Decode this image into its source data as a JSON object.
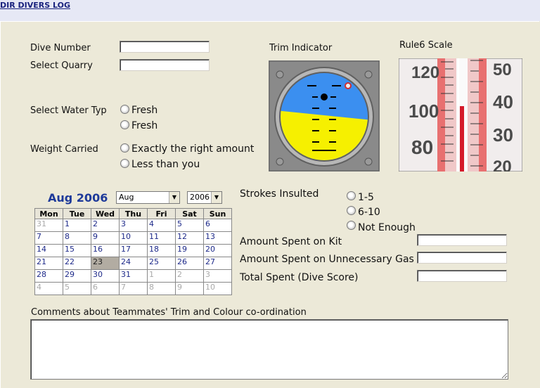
{
  "header": {
    "link": "DIR DIVERS LOG"
  },
  "form": {
    "dive_number_label": "Dive Number",
    "dive_number_value": "",
    "quarry_label": "Select Quarry",
    "quarry_value": "",
    "water_label": "Select Water Typ",
    "water_options": [
      "Fresh",
      "Fresh"
    ],
    "weight_label": "Weight Carried",
    "weight_options": [
      "Exactly the right amount",
      "Less than you"
    ],
    "strokes_label": "Strokes Insulted",
    "strokes_options": [
      "1-5",
      "6-10",
      "Not Enough"
    ],
    "kit_label": "Amount Spent on Kit",
    "gas_label": "Amount Spent on Unnecessary Gas",
    "total_label": "Total Spent (Dive Score)",
    "comments_label": "Comments about Teammates' Trim and Colour co-ordination"
  },
  "trim": {
    "title": "Trim Indicator"
  },
  "rule6": {
    "title": "Rule6 Scale",
    "scale_left": [
      "120",
      "100",
      "80"
    ],
    "scale_right": [
      "50",
      "40",
      "30",
      "20"
    ]
  },
  "calendar": {
    "title": "Aug 2006",
    "month_select": "Aug",
    "year_select": "2006",
    "days": [
      "Mon",
      "Tue",
      "Wed",
      "Thu",
      "Fri",
      "Sat",
      "Sun"
    ],
    "weeks": [
      [
        "31",
        "1",
        "2",
        "3",
        "4",
        "5",
        "6"
      ],
      [
        "7",
        "8",
        "9",
        "10",
        "11",
        "12",
        "13"
      ],
      [
        "14",
        "15",
        "16",
        "17",
        "18",
        "19",
        "20"
      ],
      [
        "21",
        "22",
        "23",
        "24",
        "25",
        "26",
        "27"
      ],
      [
        "28",
        "29",
        "30",
        "31",
        "1",
        "2",
        "3"
      ],
      [
        "4",
        "5",
        "6",
        "7",
        "8",
        "9",
        "10"
      ]
    ],
    "selected": "23"
  }
}
